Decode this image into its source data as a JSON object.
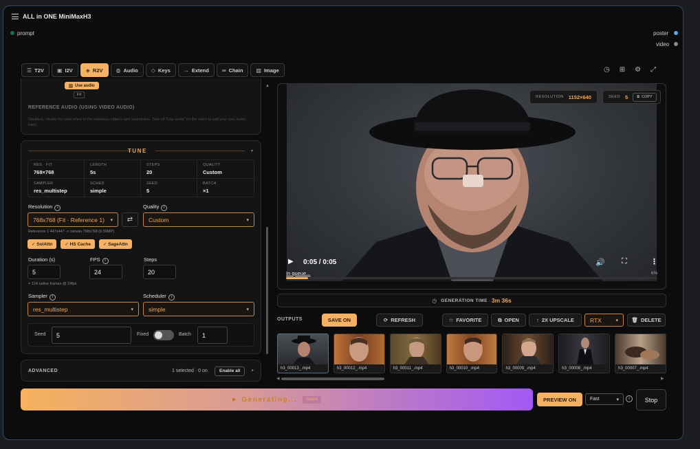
{
  "node": {
    "title": "ALL in ONE MiniMaxH3",
    "input_port": "prompt",
    "output_ports": [
      "poster",
      "video"
    ]
  },
  "tabs": [
    {
      "label": "T2V",
      "icon": "☰"
    },
    {
      "label": "I2V",
      "icon": "▣"
    },
    {
      "label": "R2V",
      "icon": "◈",
      "active": true
    },
    {
      "label": "Audio",
      "icon": "◍"
    },
    {
      "label": "Keys",
      "icon": "◇"
    },
    {
      "label": "Extend",
      "icon": "→"
    },
    {
      "label": "Chain",
      "icon": "∞"
    },
    {
      "label": "Image",
      "icon": "▨"
    }
  ],
  "ref_audio": {
    "use_audio_label": "Use audio",
    "pill": "F#",
    "section_label": "REFERENCE AUDIO (USING VIDEO AUDIO)",
    "description": "Disabled, <Audio fn> now refers to the reference video's own soundtrack. Turn off \"Use audio\" on the video to add your own audio track."
  },
  "tune": {
    "title": "TUNE",
    "summary": [
      {
        "k": "RES · FIT",
        "v": "768×768"
      },
      {
        "k": "LENGTH",
        "v": "5s"
      },
      {
        "k": "STEPS",
        "v": "20"
      },
      {
        "k": "QUALITY",
        "v": "Custom"
      },
      {
        "k": "SAMPLER",
        "v": "res_multistep"
      },
      {
        "k": "SCHED",
        "v": "simple"
      },
      {
        "k": "SEED",
        "v": "5"
      },
      {
        "k": "BATCH",
        "v": "×1"
      }
    ],
    "resolution_label": "Resolution",
    "resolution_value": "768x768 (Fit · Reference 1)",
    "quality_label": "Quality",
    "quality_value": "Custom",
    "ref_note": "Reference 1 447x447 -> canvas 768x768 (0.59MP)",
    "chips": [
      "✓ SolAttn",
      "✓ HS Cache",
      "✓ SageAttn"
    ],
    "duration_label": "Duration (s)",
    "duration_value": "5",
    "fps_label": "FPS",
    "fps_value": "24",
    "steps_label": "Steps",
    "steps_value": "20",
    "frames_note": "= 124 native frames @ 24fps",
    "sampler_label": "Sampler",
    "sampler_value": "res_multistep",
    "scheduler_label": "Scheduler",
    "scheduler_value": "simple",
    "seed_label": "Seed",
    "seed_value": "5",
    "fixed_label": "Fixed",
    "batch_label": "Batch",
    "batch_value": "1"
  },
  "advanced": {
    "title": "ADVANCED",
    "status": "1 selected · 0 on",
    "enable_all": "Enable all"
  },
  "preview": {
    "resolution_label": "RESOLUTION",
    "resolution_value": "1152×640",
    "seed_label": "SEED",
    "seed_value": "5",
    "copy_label": "COPY",
    "time": "0:05 / 0:05",
    "queue_text": "In queue...",
    "progress_pct": "6%",
    "progress_fraction": 0.06
  },
  "gen_time": {
    "label": "GENERATION TIME",
    "value": "3m 36s"
  },
  "outputs": {
    "label": "OUTPUTS",
    "save_on": "SAVE ON",
    "refresh": "REFRESH",
    "favorite": "FAVORITE",
    "open": "OPEN",
    "upscale": "2X UPSCALE",
    "rtx": "RTX",
    "delete": "DELETE",
    "thumbs": [
      "h3_00013_.mp4",
      "h3_00012_.mp4",
      "h3_00011_.mp4",
      "h3_00010_.mp4",
      "h3_00009_.mp4",
      "h3_00008_.mp4",
      "h3_00007_.mp4"
    ]
  },
  "footer": {
    "generate_label": "Generating...",
    "generate_badge": "Space",
    "preview_on": "PREVIEW ON",
    "speed": "Fast",
    "stop": "Stop"
  },
  "colors": {
    "accent": "#f5b264",
    "border": "#2f4a66",
    "gradient_start": "#f6b25c",
    "gradient_end": "#a259f5"
  }
}
